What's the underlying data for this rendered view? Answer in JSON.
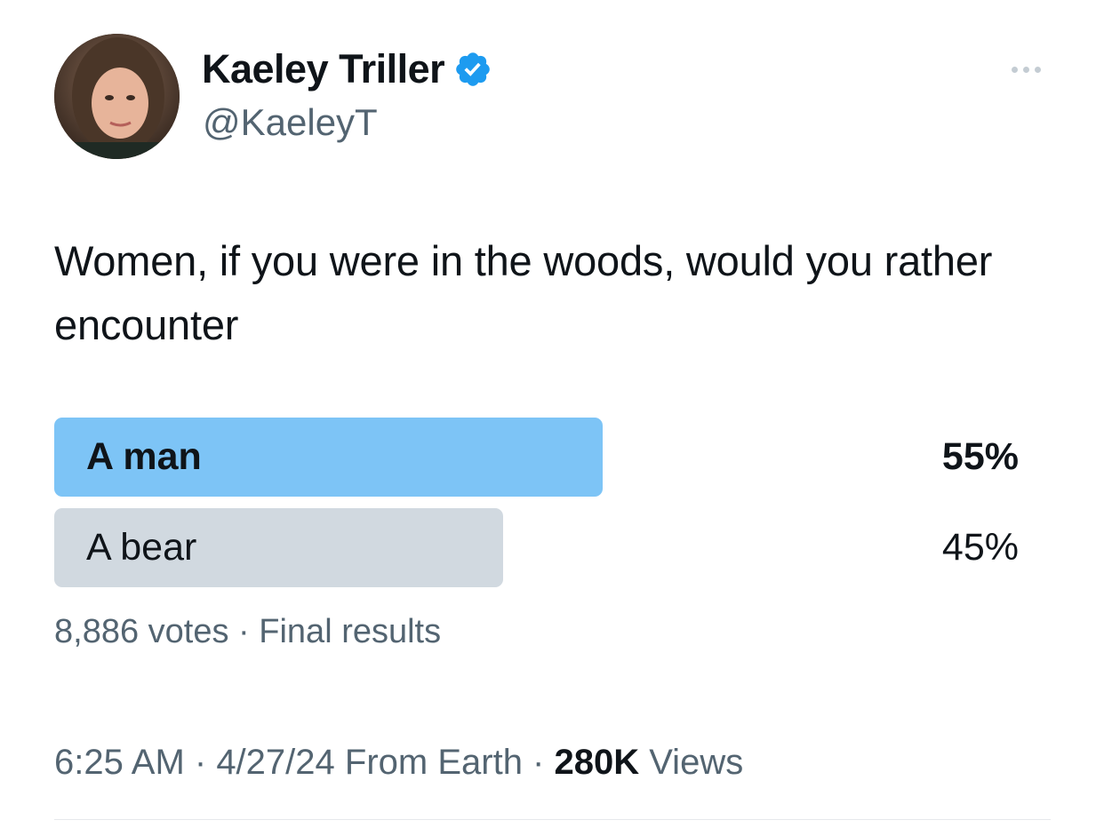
{
  "author": {
    "display_name": "Kaeley Triller",
    "handle": "@KaeleyT",
    "verified": true,
    "avatar_icon": "profile-photo"
  },
  "tweet": {
    "text": "Women, if you were in the woods, would you rather encounter"
  },
  "poll": {
    "options": [
      {
        "label": "A man",
        "percent_text": "55%",
        "percent": 55,
        "winner": true
      },
      {
        "label": "A bear",
        "percent_text": "45%",
        "percent": 45,
        "winner": false
      }
    ],
    "votes_text": "8,886 votes",
    "separator": " · ",
    "status_text": "Final results"
  },
  "meta": {
    "time": "6:25 AM",
    "sep1": " · ",
    "date": "4/27/24",
    "source": " From Earth",
    "sep2": " · ",
    "views_count": "280K",
    "views_label": " Views"
  },
  "colors": {
    "winner_bar": "#7dc4f6",
    "other_bar": "#d1d9e0",
    "verified_badge": "#1d9bf0",
    "secondary_text": "#536471",
    "primary_text": "#0f1419"
  },
  "icons": {
    "verified": "verified-badge-icon",
    "more": "more-options-icon"
  }
}
